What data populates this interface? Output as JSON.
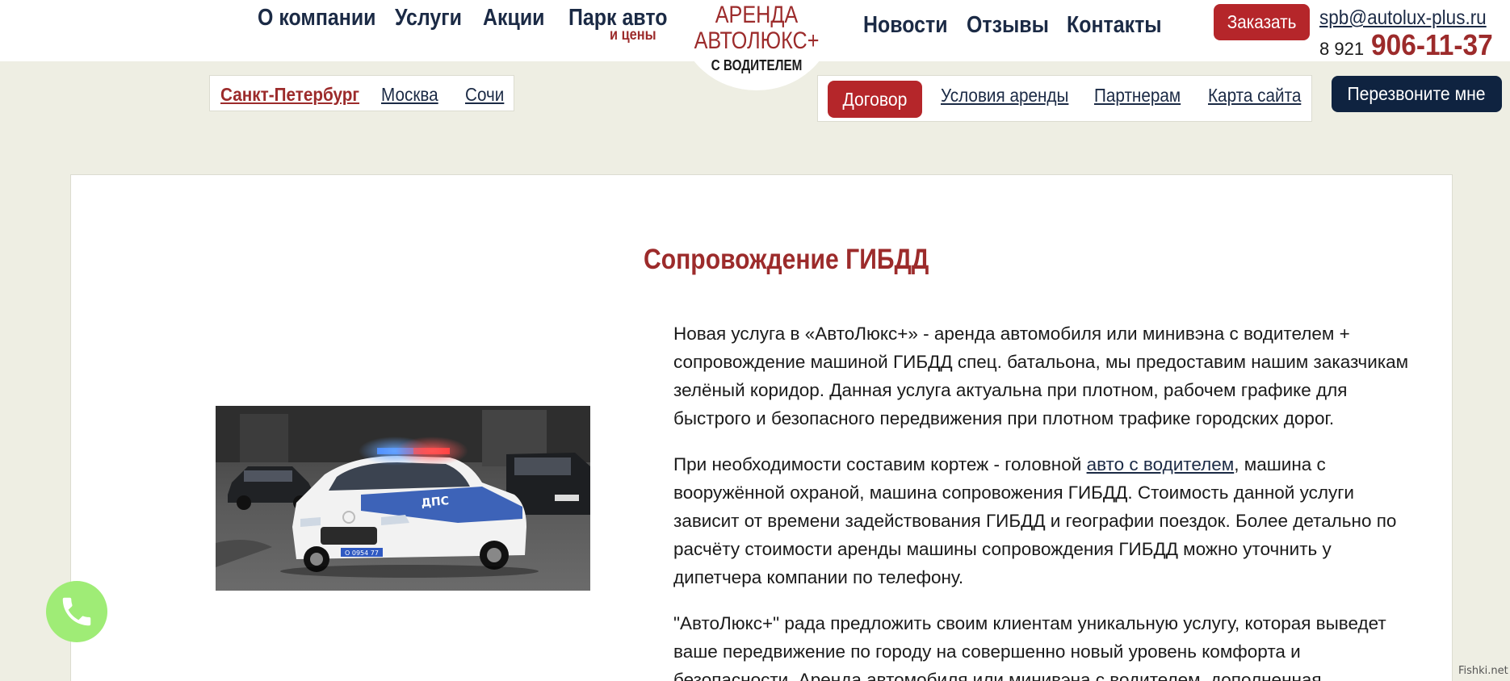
{
  "header": {
    "nav": [
      {
        "label": "О компании"
      },
      {
        "label": "Услуги"
      },
      {
        "label": "Акции"
      },
      {
        "label": "Парк авто",
        "sub": "и цены"
      },
      {
        "label": "Новости"
      },
      {
        "label": "Отзывы"
      },
      {
        "label": "Контакты"
      }
    ],
    "logo": {
      "line1": "АРЕНДА",
      "line2": "АВТОЛЮКС+",
      "line3": "С ВОДИТЕЛЕМ"
    },
    "order_button": "Заказать",
    "email": "spb@autolux-plus.ru",
    "phone_prefix": "8 921",
    "phone_number": "906-11-37"
  },
  "cities": {
    "items": [
      "Санкт-Петербург",
      "Москва",
      "Сочи"
    ],
    "active": "Санкт-Петербург"
  },
  "infobar": {
    "contract_button": "Договор",
    "links": [
      "Условия аренды",
      "Партнерам",
      "Карта сайта"
    ]
  },
  "callback_button": "Перезвоните мне",
  "main": {
    "title": "Сопровождение ГИБДД",
    "image": {
      "plate": "О 0954 77",
      "livery": "ДПС"
    },
    "p1": "Новая услуга в «АвтоЛюкс+» - аренда автомобиля или минивэна с водителем + сопровождение машиной ГИБДД спец. батальона, мы предоставим нашим заказчикам зелёный коридор. Данная услуга актуальна при плотном, рабочем графике для быстрого и безопасного передвижения при плотном трафике городских дорог.",
    "p2_before": "При необходимости составим кортеж - головной ",
    "p2_link": "авто с водителем",
    "p2_after": ", машина с вооружённой охраной, машина сопровожения ГИБДД. Стоимость данной услуги зависит от времени задействования ГИБДД и географии поездок. Более детально по расчёту стоимости аренды машины сопровождения ГИБДД можно уточнить у дипетчера компании по телефону.",
    "p3": "\"АвтоЛюкс+\" рада предложить своим клиентам уникальную услугу, которая выведет ваше передвижение по городу на совершенно новый уровень комфорта и безопасности. Аренда автомобиля или минивэна с водителем, дополненная"
  },
  "watermark": "Fishki.net",
  "colors": {
    "brand_red": "#9c2b2b",
    "button_red": "#b5262a",
    "navy": "#0f2340",
    "page_bg": "#eeeee3",
    "call_green": "#9fec76"
  },
  "icons": {
    "call_fab": "phone-handset-icon"
  }
}
